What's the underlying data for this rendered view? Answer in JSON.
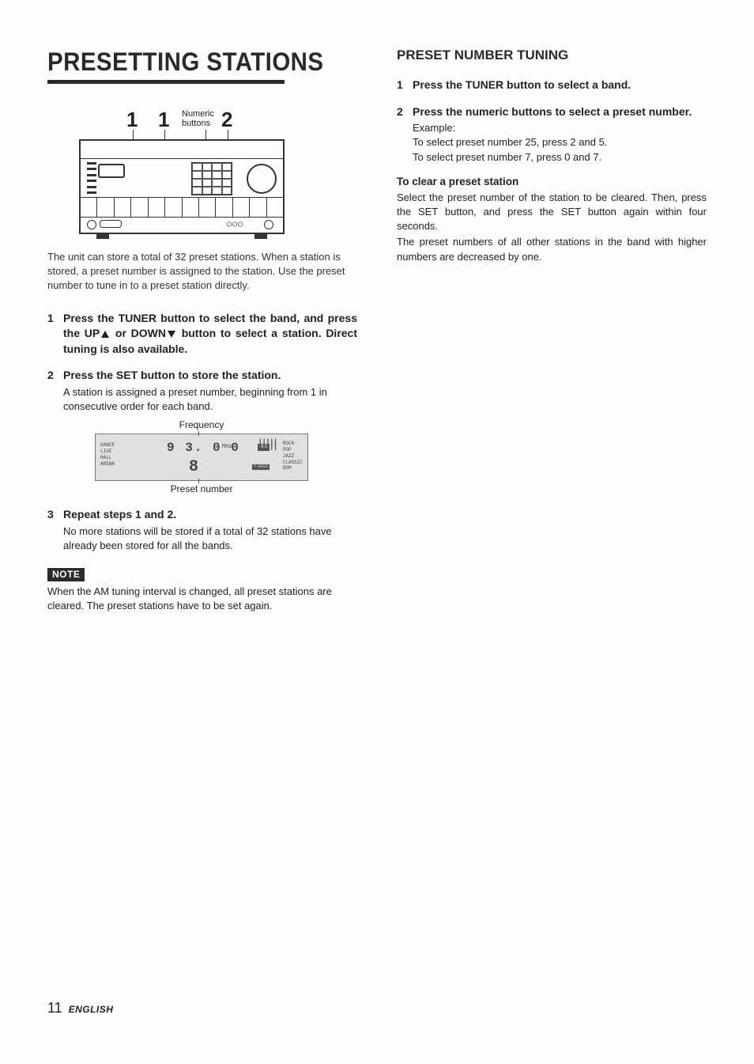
{
  "left": {
    "title": "PRESETTING STATIONS",
    "callouts": {
      "one": "1",
      "numeric": "Numeric\nbuttons",
      "two": "2"
    },
    "intro": "The unit can store a total of 32 preset stations. When a station is stored, a preset number is assigned to the station. Use the preset number to tune in to a preset station directly.",
    "steps": [
      {
        "head_pre": "Press the TUNER button to select the band, and press the UP",
        "head_mid": " or DOWN",
        "head_post": " button to select a station. Direct tuning is also available.",
        "body": ""
      },
      {
        "head": "Press the SET button to store the station.",
        "body": "A station is assigned a preset number, beginning from 1 in consecutive order for each band."
      },
      {
        "head": "Repeat steps 1 and 2.",
        "body": "No more stations will be stored if a total of 32 stations have already been stored for all the bands."
      }
    ],
    "lcd": {
      "top_label": "Frequency",
      "bottom_label": "Preset number",
      "freq": "9 3. 0 0",
      "mhz": "MHz",
      "preset": "8",
      "left_labels": "DANCE\nLIVE\nHALL\nARENA",
      "right_labels": "ROCK\nPOP\nJAZZ\nCLASSIC\nBGM",
      "bbe": "BBE",
      "tbass": "T-BASS"
    },
    "note_badge": "NOTE",
    "note_text": "When the AM tuning interval is changed, all preset stations are cleared. The preset stations have to be set again."
  },
  "right": {
    "heading": "PRESET NUMBER TUNING",
    "steps": [
      {
        "head": "Press the TUNER button to select a band.",
        "body": ""
      },
      {
        "head": "Press the numeric buttons to select a preset number.",
        "example_label": "Example:",
        "example1": "To select preset number 25, press 2 and 5.",
        "example2": "To select preset number 7, press 0 and 7."
      }
    ],
    "clear_head": "To clear a preset station",
    "clear_body1": "Select the preset number of the station to be cleared. Then, press the SET button, and press the SET button again within four seconds.",
    "clear_body2": "The preset numbers of all other stations in the band with higher numbers are decreased by one."
  },
  "footer": {
    "page": "11",
    "lang": "ENGLISH"
  }
}
